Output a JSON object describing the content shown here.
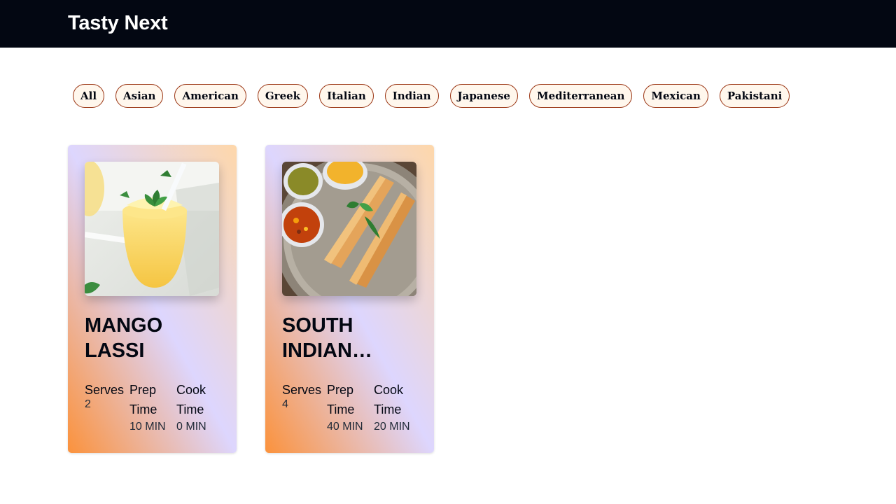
{
  "header": {
    "brand": "Tasty Next"
  },
  "filters": [
    "All",
    "Asian",
    "American",
    "Greek",
    "Italian",
    "Indian",
    "Japanese",
    "Mediterranean",
    "Mexican",
    "Pakistani"
  ],
  "recipes": [
    {
      "title": "MANGO LASSI",
      "serves_label": "Serves",
      "serves": "2",
      "prep_label": "Prep Time",
      "prep": "10 MIN",
      "cook_label": "Cook Time",
      "cook": "0 MIN"
    },
    {
      "title": "SOUTH INDIAN…",
      "serves_label": "Serves",
      "serves": "4",
      "prep_label": "Prep Time",
      "prep": "40 MIN",
      "cook_label": "Cook Time",
      "cook": "20 MIN"
    }
  ],
  "colors": {
    "header_bg": "#030712",
    "chip_border": "#9a3412",
    "chip_bg": "#fff7ed",
    "card_gradient_orange": "#fb923c",
    "card_gradient_lavender": "#ddd6fe",
    "card_gradient_peach": "#fed7aa"
  }
}
